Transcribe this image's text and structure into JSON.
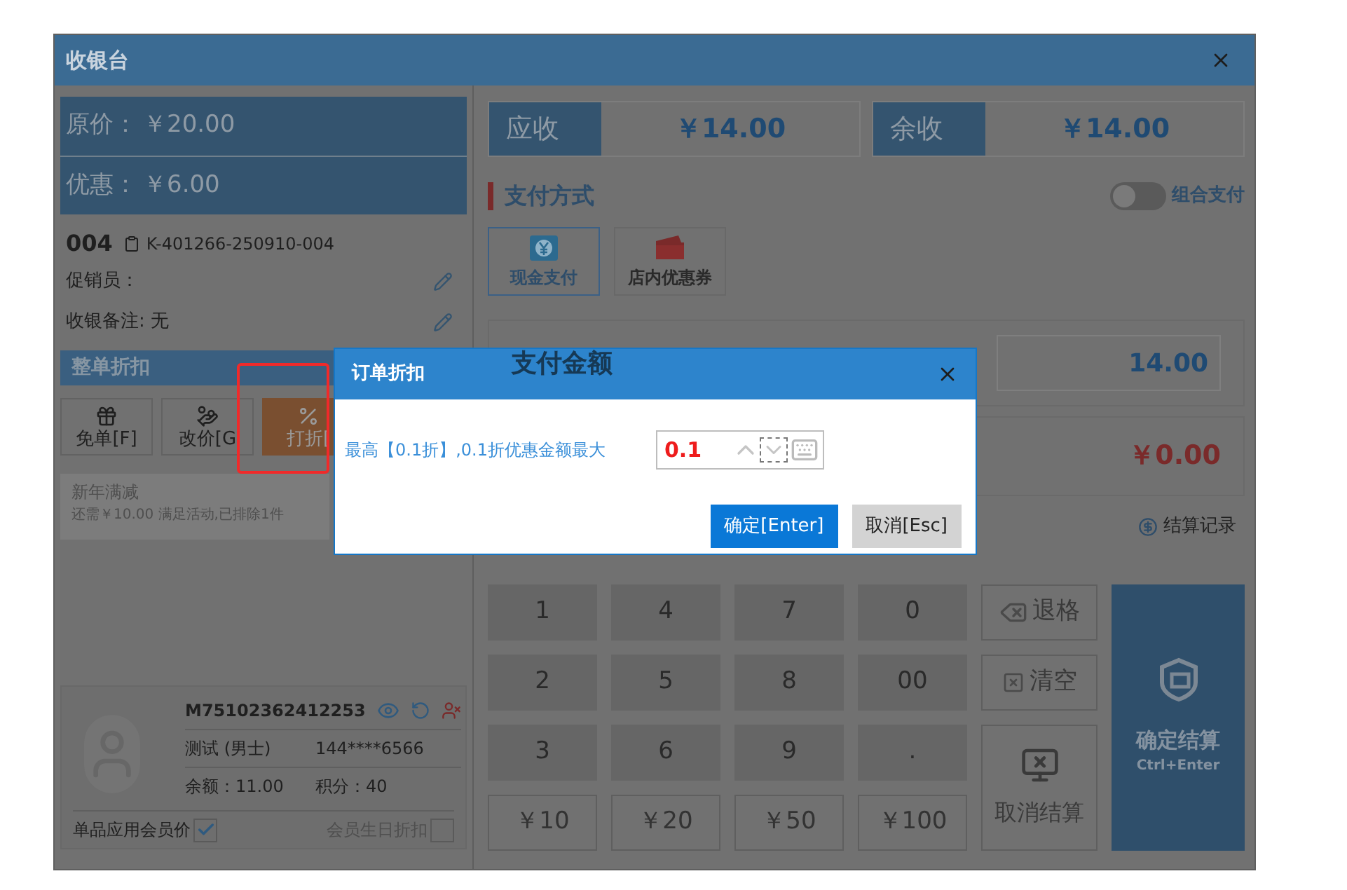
{
  "window": {
    "title": "收银台"
  },
  "summary": [
    {
      "label": "原价：",
      "value": "￥20.00"
    },
    {
      "label": "优惠：",
      "value": "￥6.00"
    }
  ],
  "order": {
    "number": "004",
    "code": "K-401266-250910-004"
  },
  "info_rows": [
    "促销员：",
    "收银备注: 无"
  ],
  "whole_discount": {
    "title": "整单折扣",
    "buttons": [
      {
        "kind": "gift",
        "label": "免单[F]",
        "selected": false
      },
      {
        "kind": "price",
        "label": "改价[G",
        "selected": false
      },
      {
        "kind": "percent",
        "label": "打折[",
        "selected": true
      }
    ]
  },
  "promotion": {
    "title": "新年满减",
    "text": "还需￥10.00 满足活动,已排除1件"
  },
  "member": {
    "id": "M75102362412253",
    "name": "测试 (男士)",
    "phone": "144****6566",
    "balance": "余额：11.00",
    "points": "积分：40",
    "options": [
      {
        "label": "单品应用会员价",
        "checked": true
      },
      {
        "label": "会员生日折扣",
        "checked": false
      }
    ]
  },
  "totals": [
    {
      "label": "应收",
      "value": "￥14.00"
    },
    {
      "label": "余收",
      "value": "￥14.00"
    }
  ],
  "payment": {
    "title": "支付方式",
    "combo": {
      "label": "组合支付",
      "on": false
    },
    "methods": [
      {
        "kind": "cash",
        "label": "现金支付",
        "selected": true
      },
      {
        "kind": "coupon",
        "label": "店内优惠券",
        "selected": false
      }
    ],
    "amount_label": "支付金额",
    "amount": "14.00",
    "change": "￥0.00",
    "history_link": "结算记录"
  },
  "keypad": {
    "columns": [
      [
        "1",
        "2",
        "3",
        "￥10"
      ],
      [
        "4",
        "5",
        "6",
        "￥20"
      ],
      [
        "7",
        "8",
        "9",
        "￥50"
      ],
      [
        "0",
        "00",
        ".",
        "￥100"
      ]
    ],
    "backspace": "退格",
    "clear": "清空",
    "cancel": "取消结算",
    "confirm": "确定结算",
    "confirm_hint": "Ctrl+Enter"
  },
  "dialog": {
    "title": "订单折扣",
    "message": "最高【0.1折】,0.1折优惠金额最大",
    "value": "0.1",
    "ok": "确定[Enter]",
    "cancel": "取消[Esc]"
  }
}
